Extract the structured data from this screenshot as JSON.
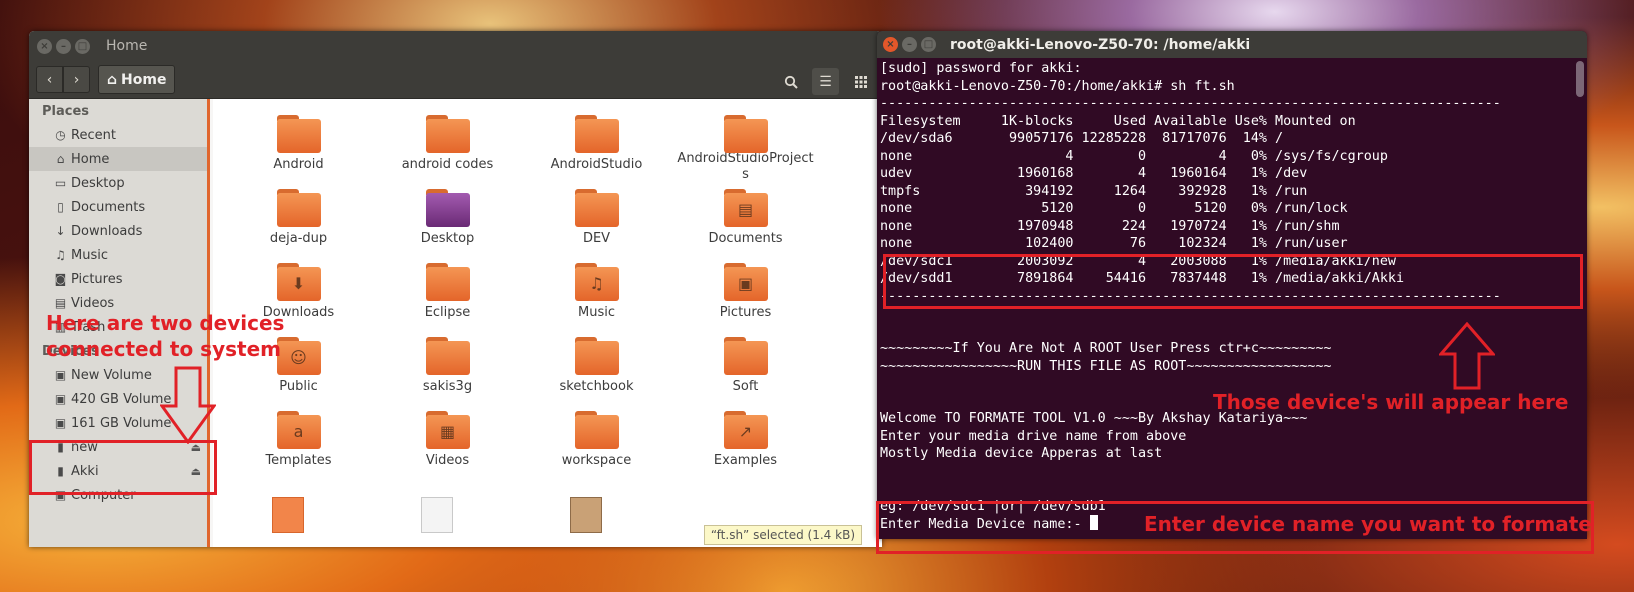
{
  "nautilus": {
    "window_title": "Home",
    "path_button": "Home",
    "sidebar": {
      "places_header": "Places",
      "places": [
        {
          "icon": "clock-icon",
          "glyph": "◷",
          "label": "Recent"
        },
        {
          "icon": "home-icon",
          "glyph": "⌂",
          "label": "Home"
        },
        {
          "icon": "folder-icon",
          "glyph": "▭",
          "label": "Desktop"
        },
        {
          "icon": "document-icon",
          "glyph": "▯",
          "label": "Documents"
        },
        {
          "icon": "download-icon",
          "glyph": "↓",
          "label": "Downloads"
        },
        {
          "icon": "music-icon",
          "glyph": "♫",
          "label": "Music"
        },
        {
          "icon": "camera-icon",
          "glyph": "◙",
          "label": "Pictures"
        },
        {
          "icon": "video-icon",
          "glyph": "▤",
          "label": "Videos"
        },
        {
          "icon": "trash-icon",
          "glyph": "▥",
          "label": "Trash"
        }
      ],
      "devices_header": "Devices",
      "devices": [
        {
          "icon": "drive-icon",
          "glyph": "▣",
          "label": "New Volume"
        },
        {
          "icon": "drive-icon",
          "glyph": "▣",
          "label": "420 GB Volume"
        },
        {
          "icon": "drive-icon",
          "glyph": "▣",
          "label": "161 GB Volume"
        },
        {
          "icon": "usb-icon",
          "glyph": "▮",
          "label": "new",
          "eject": "⏏"
        },
        {
          "icon": "usb-icon",
          "glyph": "▮",
          "label": "Akki",
          "eject": "⏏"
        },
        {
          "icon": "computer-icon",
          "glyph": "▣",
          "label": "Computer"
        }
      ]
    },
    "files": [
      {
        "name": "Android",
        "kind": "folder",
        "emblem": ""
      },
      {
        "name": "android codes",
        "kind": "folder",
        "emblem": ""
      },
      {
        "name": "AndroidStudio",
        "kind": "folder",
        "emblem": ""
      },
      {
        "name": "AndroidStudioProjects",
        "kind": "folder",
        "emblem": ""
      },
      {
        "name": "deja-dup",
        "kind": "folder",
        "emblem": ""
      },
      {
        "name": "Desktop",
        "kind": "folder-purple",
        "emblem": ""
      },
      {
        "name": "DEV",
        "kind": "folder",
        "emblem": ""
      },
      {
        "name": "Documents",
        "kind": "folder",
        "emblem": "▤"
      },
      {
        "name": "Downloads",
        "kind": "folder",
        "emblem": "⬇"
      },
      {
        "name": "Eclipse",
        "kind": "folder",
        "emblem": ""
      },
      {
        "name": "Music",
        "kind": "folder",
        "emblem": "♫"
      },
      {
        "name": "Pictures",
        "kind": "folder",
        "emblem": "▣"
      },
      {
        "name": "Public",
        "kind": "folder",
        "emblem": "☺"
      },
      {
        "name": "sakis3g",
        "kind": "folder",
        "emblem": ""
      },
      {
        "name": "sketchbook",
        "kind": "folder",
        "emblem": ""
      },
      {
        "name": "Soft",
        "kind": "folder",
        "emblem": ""
      },
      {
        "name": "Templates",
        "kind": "folder",
        "emblem": "a"
      },
      {
        "name": "Videos",
        "kind": "folder",
        "emblem": "▦"
      },
      {
        "name": "workspace",
        "kind": "folder",
        "emblem": ""
      },
      {
        "name": "Examples",
        "kind": "folder",
        "emblem": "↗"
      }
    ],
    "status": "“ft.sh” selected  (1.4 kB)"
  },
  "terminal": {
    "window_title": "root@akki-Lenovo-Z50-70: /home/akki",
    "lines": [
      "[sudo] password for akki:",
      "root@akki-Lenovo-Z50-70:/home/akki# sh ft.sh",
      "-----------------------------------------------------------------------------",
      "Filesystem     1K-blocks     Used Available Use% Mounted on",
      "/dev/sda6       99057176 12285228  81717076  14% /",
      "none                   4        0         4   0% /sys/fs/cgroup",
      "udev             1960168        4   1960164   1% /dev",
      "tmpfs             394192     1264    392928   1% /run",
      "none                5120        0      5120   0% /run/lock",
      "none             1970948      224   1970724   1% /run/shm",
      "none              102400       76    102324   1% /run/user",
      "/dev/sdc1        2003092        4   2003088   1% /media/akki/new",
      "/dev/sdd1        7891864    54416   7837448   1% /media/akki/Akki",
      "-----------------------------------------------------------------------------",
      "",
      "",
      "~~~~~~~~~If You Are Not A ROOT User Press ctr+c~~~~~~~~~",
      "~~~~~~~~~~~~~~~~~RUN THIS FILE AS ROOT~~~~~~~~~~~~~~~~~~",
      "",
      "",
      "Welcome TO FORMATE TOOL V1.0 ~~~By Akshay Katariya~~~",
      "Enter your media drive name from above",
      "Mostly Media device Apperas at last",
      "",
      "",
      "eg: /dev/sdc1 |or| /dev/sdb1",
      "Enter Media Device name:-"
    ]
  },
  "annotations": {
    "devices_note_line1": "Here are two devices",
    "devices_note_line2": "connected to system",
    "terminal_note": "Those device's will appear here",
    "input_note": "Enter device name you want to formate",
    "color": "#e12127"
  }
}
